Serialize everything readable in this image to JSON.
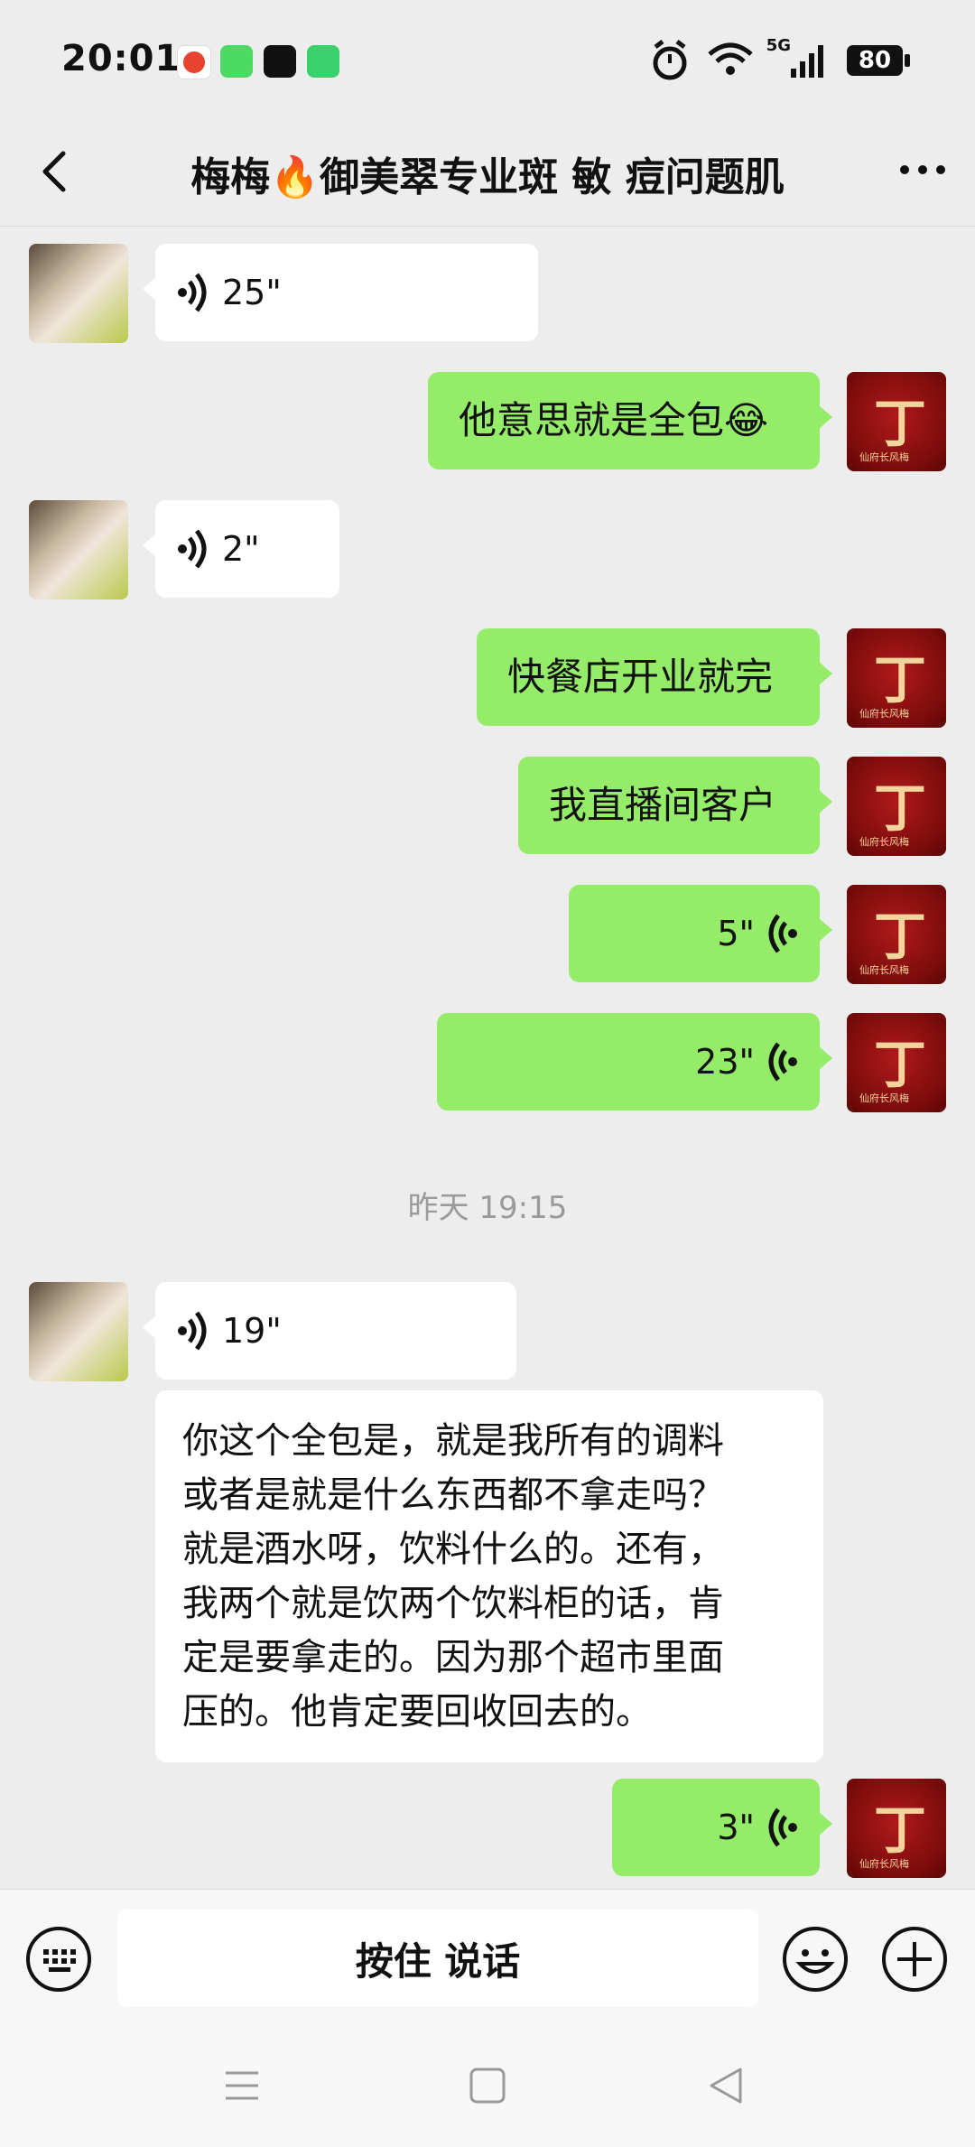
{
  "status_bar": {
    "time": "20:01",
    "network": "5G",
    "battery": "80"
  },
  "header": {
    "title": "梅梅🔥御美翠专业斑 敏 痘问题肌",
    "back_icon": "chevron-left-icon",
    "more_icon": "more-dots-icon"
  },
  "messages": [
    {
      "side": "left",
      "kind": "voice",
      "duration": "25\""
    },
    {
      "side": "right",
      "kind": "text",
      "text": "他意思就是全包😂"
    },
    {
      "side": "left",
      "kind": "voice",
      "duration": "2\""
    },
    {
      "side": "right",
      "kind": "text",
      "text": "快餐店开业就完"
    },
    {
      "side": "right",
      "kind": "text",
      "text": "我直播间客户"
    },
    {
      "side": "right",
      "kind": "voice",
      "duration": "5\""
    },
    {
      "side": "right",
      "kind": "voice",
      "duration": "23\""
    },
    {
      "side": "left",
      "kind": "voice",
      "duration": "19\""
    },
    {
      "side": "left",
      "kind": "text",
      "lines": [
        "你这个全包是，就是我所有的调料",
        "或者是就是什么东西都不拿走吗？",
        "就是酒水呀，饮料什么的。还有，",
        "我两个就是饮两个饮料柜的话，肯",
        "定是要拿走的。因为那个超市里面",
        "压的。他肯定要回收回去的。"
      ]
    },
    {
      "side": "right",
      "kind": "voice",
      "duration": "3\""
    }
  ],
  "timestamp": "昨天 19:15",
  "input_bar": {
    "hold_to_talk": "按住 说话",
    "keyboard_icon": "keyboard-icon",
    "emoji_icon": "emoji-icon",
    "plus_icon": "plus-icon"
  },
  "avatar_right": {
    "glyph": "丁",
    "caption": "仙府长风梅"
  },
  "colors": {
    "background": "#ededed",
    "bubble_self": "#95ec69",
    "bubble_other": "#ffffff"
  }
}
